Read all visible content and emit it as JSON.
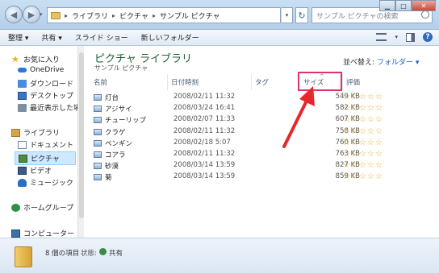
{
  "address": {
    "crumbs": [
      "ライブラリ",
      "ピクチャ",
      "サンプル ピクチャ"
    ],
    "search_placeholder": "サンプル ピクチャの検索"
  },
  "toolbar": {
    "organize": "整理 ▾",
    "share": "共有 ▾",
    "slideshow": "スライド ショー",
    "new_folder": "新しいフォルダー"
  },
  "nav": {
    "favorites": "お気に入り",
    "onedrive": "OneDrive",
    "downloads": "ダウンロード",
    "desktop": "デスクトップ",
    "recent": "最近表示した場所",
    "libraries": "ライブラリ",
    "documents": "ドキュメント",
    "pictures": "ピクチャ",
    "videos": "ビデオ",
    "music": "ミュージック",
    "homegroup": "ホームグループ",
    "computer": "コンピューター"
  },
  "library": {
    "title": "ピクチャ ライブラリ",
    "subtitle": "サンプル ピクチャ",
    "arrange_label": "並べ替え:",
    "arrange_value": "フォルダー ▾"
  },
  "columns": {
    "name": "名前",
    "date": "日付時刻",
    "tags": "タグ",
    "size": "サイズ",
    "rating": "評価"
  },
  "files": [
    {
      "name": "灯台",
      "date": "2008/02/11 11:32",
      "size": "549 KB",
      "rating": 0
    },
    {
      "name": "アジサイ",
      "date": "2008/03/24 16:41",
      "size": "582 KB",
      "rating": 0
    },
    {
      "name": "チューリップ",
      "date": "2008/02/07 11:33",
      "size": "607 KB",
      "rating": 0
    },
    {
      "name": "クラゲ",
      "date": "2008/02/11 11:32",
      "size": "758 KB",
      "rating": 0
    },
    {
      "name": "ペンギン",
      "date": "2008/02/18 5:07",
      "size": "760 KB",
      "rating": 0
    },
    {
      "name": "コアラ",
      "date": "2008/02/11 11:32",
      "size": "763 KB",
      "rating": 0
    },
    {
      "name": "砂漠",
      "date": "2008/03/14 13:59",
      "size": "827 KB",
      "rating": 0
    },
    {
      "name": "菊",
      "date": "2008/03/14 13:59",
      "size": "859 KB",
      "rating": 0
    }
  ],
  "status": {
    "count": "8 個の項目",
    "state_label": "状態:",
    "state_value": "共有"
  },
  "colors": {
    "highlight_box": "#e5316b",
    "arrow": "#e8262c",
    "library_title": "#1e5e2d"
  }
}
